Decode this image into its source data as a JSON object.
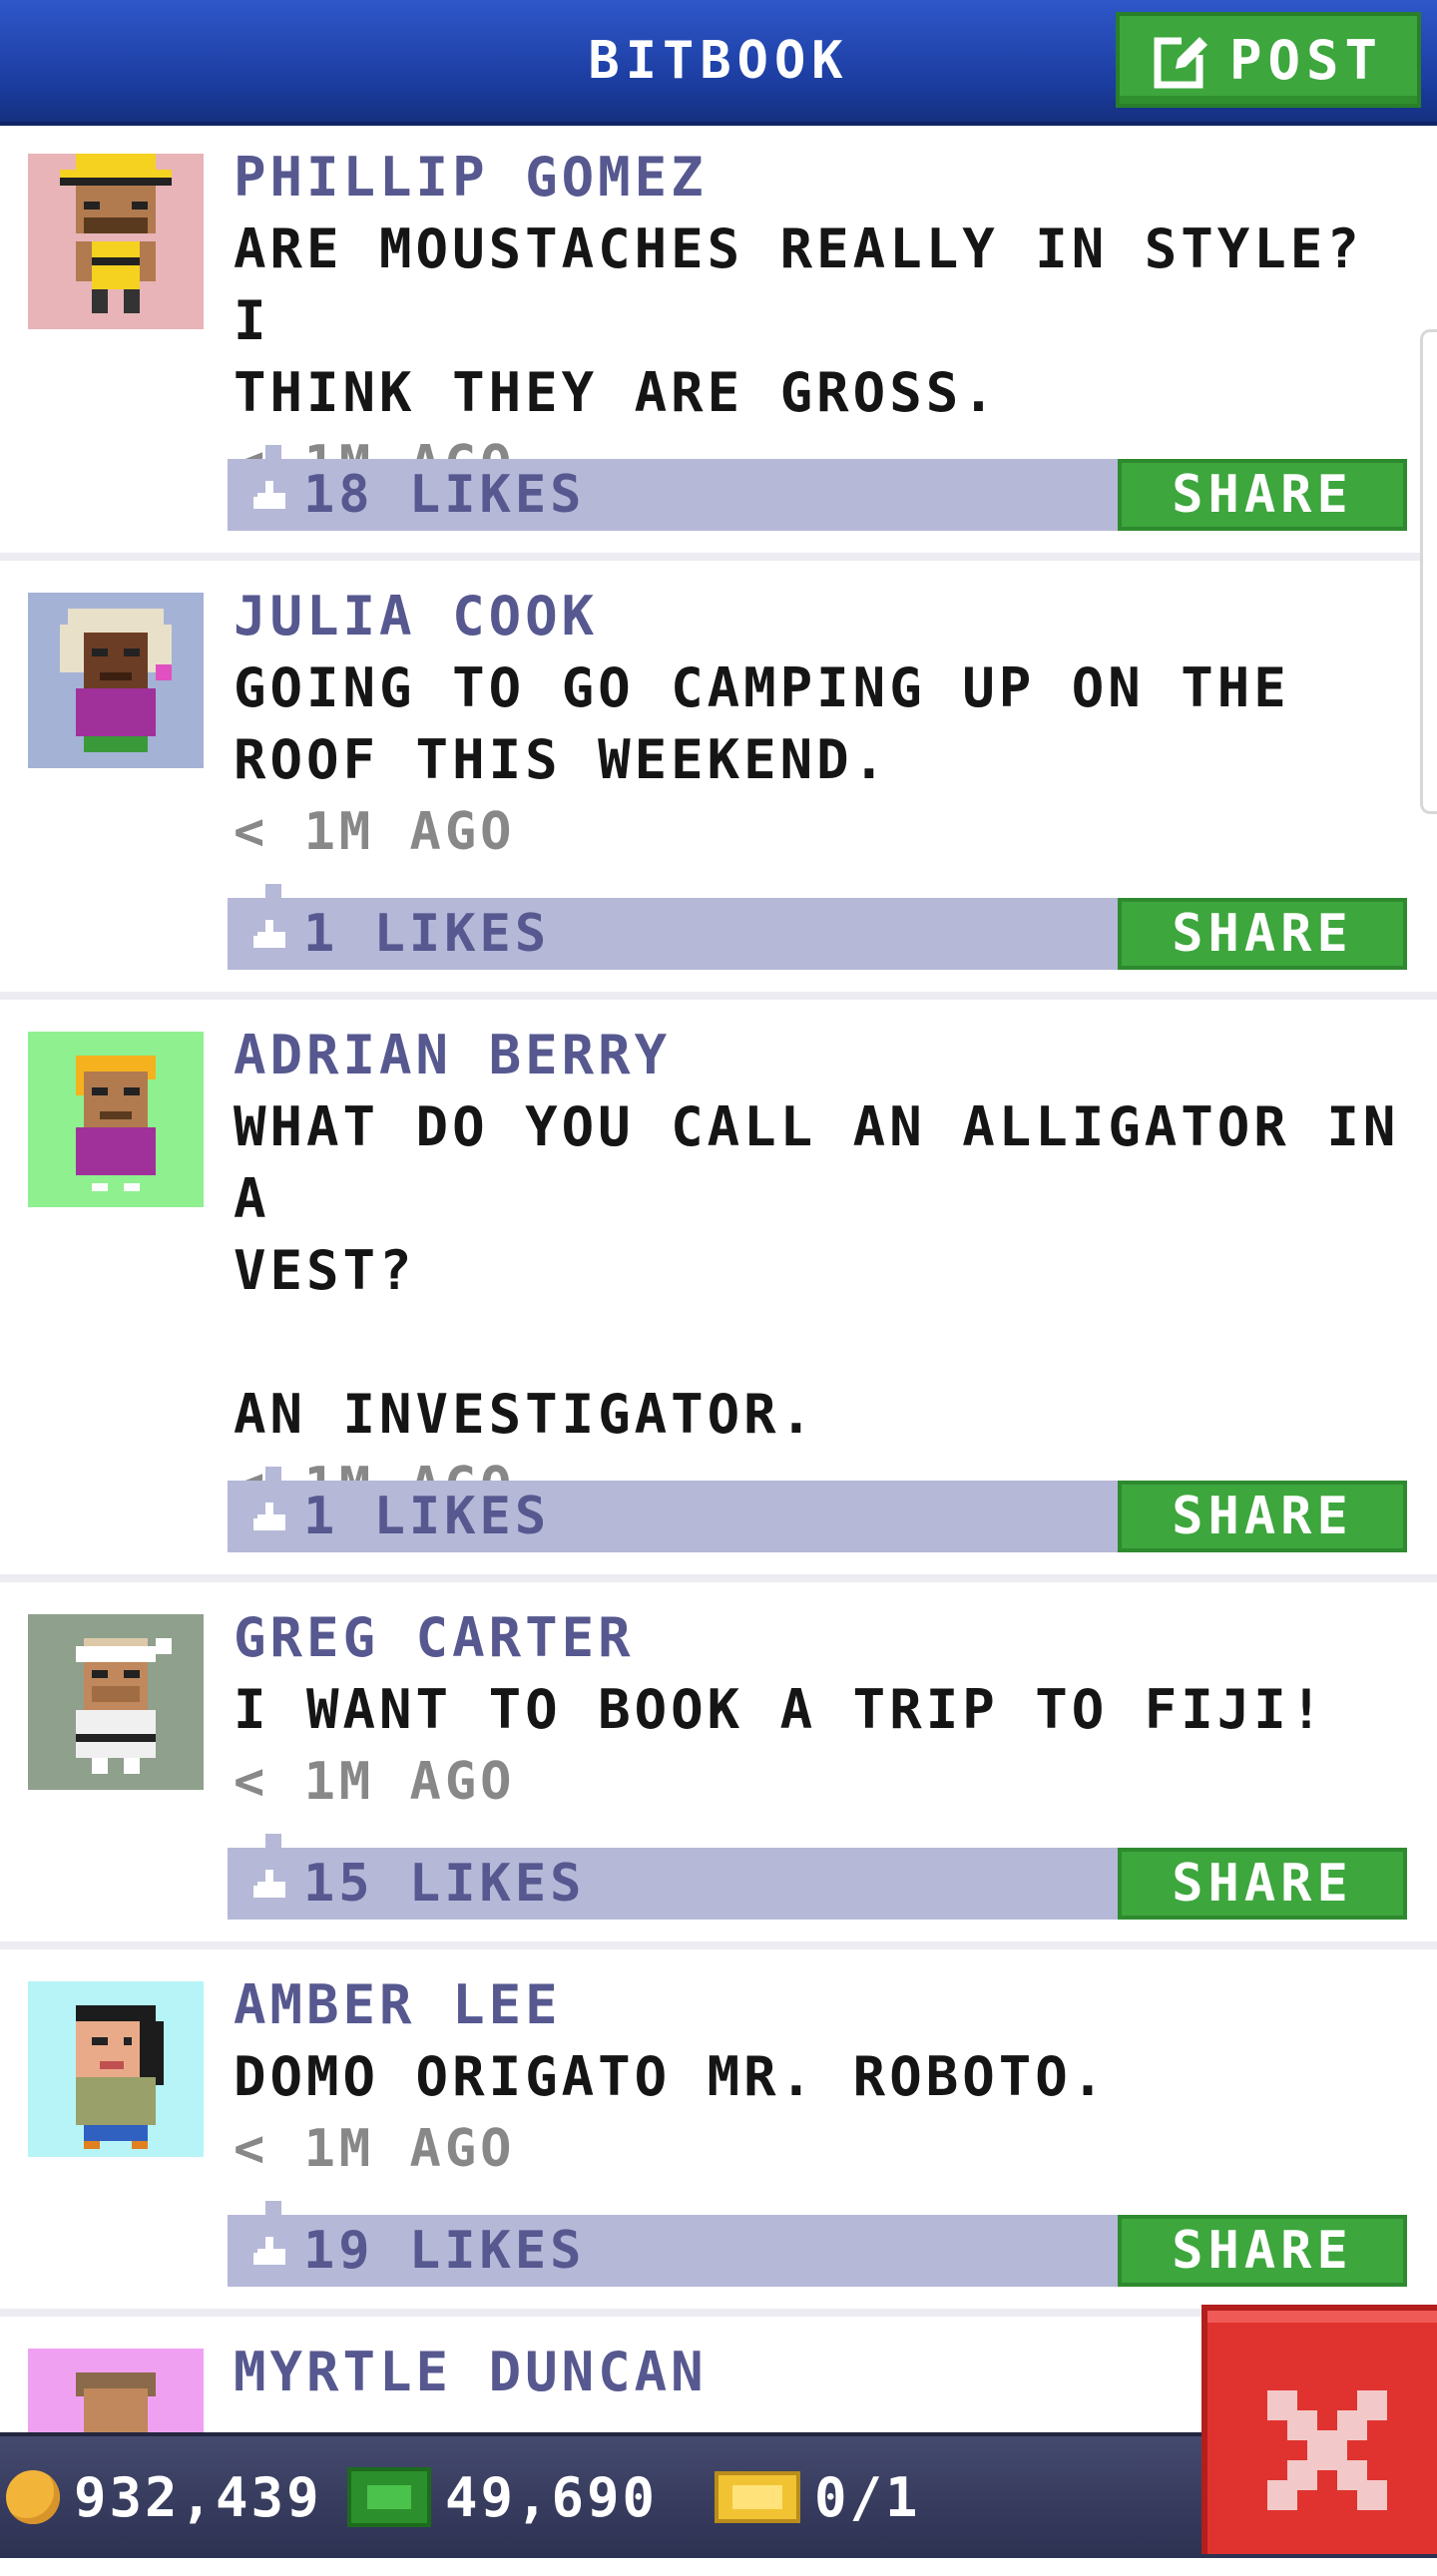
{
  "header": {
    "title": "BITBOOK",
    "post_label": "POST"
  },
  "posts": [
    {
      "name": "PHILLIP GOMEZ",
      "message": "ARE MOUSTACHES REALLY IN STYLE? I\nTHINK THEY ARE GROSS.",
      "time": "< 1M AGO",
      "likes": "18 LIKES",
      "share": "SHARE",
      "avatar_bg": "#e8b4b8"
    },
    {
      "name": "JULIA COOK",
      "message": "GOING TO GO CAMPING UP ON THE\nROOF THIS WEEKEND.",
      "time": "< 1M AGO",
      "likes": "1 LIKES",
      "share": "SHARE",
      "avatar_bg": "#a4b2d6"
    },
    {
      "name": "ADRIAN BERRY",
      "message": "WHAT DO YOU CALL AN ALLIGATOR IN A\nVEST?\n\nAN INVESTIGATOR.",
      "time": "< 1M AGO",
      "likes": "1 LIKES",
      "share": "SHARE",
      "avatar_bg": "#8ef08e"
    },
    {
      "name": "GREG CARTER",
      "message": "I WANT TO BOOK A TRIP TO FIJI!",
      "time": "< 1M AGO",
      "likes": "15 LIKES",
      "share": "SHARE",
      "avatar_bg": "#8fa08c"
    },
    {
      "name": "AMBER LEE",
      "message": "DOMO ORIGATO MR. ROBOTO.",
      "time": "< 1M AGO",
      "likes": "19 LIKES",
      "share": "SHARE",
      "avatar_bg": "#b6f4f8"
    },
    {
      "name": "MYRTLE DUNCAN",
      "message": "",
      "time": "",
      "likes": "",
      "share": "",
      "avatar_bg": "#f0a0f0"
    }
  ],
  "bottom_bar": {
    "coins": "932,439",
    "bux": "49,690",
    "tickets": "0/1"
  },
  "colors": {
    "header": "#1b3c9f",
    "green": "#3da63d",
    "likes_bar": "#b6b8d8",
    "name": "#56588f",
    "close": "#e0332f"
  },
  "icons": {
    "post": "edit-icon",
    "like": "thumbs-up-icon",
    "close": "close-icon",
    "coin": "coin-icon",
    "bux": "bux-icon",
    "ticket": "ticket-icon"
  }
}
